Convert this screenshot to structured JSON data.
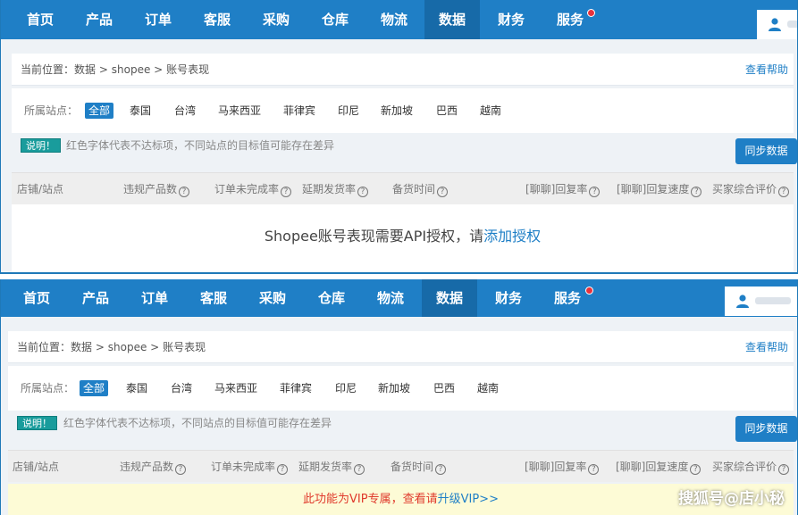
{
  "nav": {
    "items": [
      "首页",
      "产品",
      "订单",
      "客服",
      "采购",
      "仓库",
      "物流",
      "数据",
      "财务",
      "服务"
    ],
    "active": "数据"
  },
  "breadcrumb": {
    "prefix": "当前位置：",
    "path": [
      "数据",
      "shopee",
      "账号表现"
    ],
    "separator": ">"
  },
  "help_label": "查看帮助",
  "sites": {
    "label": "所属站点：",
    "options": [
      "全部",
      "泰国",
      "台湾",
      "马来西亚",
      "菲律宾",
      "印尼",
      "新加坡",
      "巴西",
      "越南"
    ],
    "selected": "全部"
  },
  "note": {
    "badge": "说明！",
    "text": "红色字体代表不达标项，不同站点的目标值可能存在差异"
  },
  "sync_button": "同步数据",
  "table": {
    "columns": [
      "店铺/站点",
      "违规产品数",
      "订单未完成率",
      "延期发货率",
      "备货时间",
      "[聊聊]回复率",
      "[聊聊]回复速度",
      "买家综合评价"
    ],
    "help_columns": [
      false,
      true,
      true,
      true,
      true,
      true,
      true,
      true
    ]
  },
  "panel_a_message": {
    "text": "Shopee账号表现需要API授权，请",
    "link": "添加授权"
  },
  "panel_b_message": {
    "text": "此功能为VIP专属，查看请",
    "link": "升级VIP>>"
  },
  "watermark": "搜狐号@店小秘",
  "colors": {
    "nav_bg": "#1f7fc6",
    "nav_active": "#176aa8",
    "accent": "#1f7fc6",
    "badge": "#199c9c",
    "warning": "#e03a2c",
    "vip_bg": "#fdfbd6"
  },
  "icons": {
    "user": "user-icon",
    "help": "question-circle-icon",
    "notification": "notification-dot-icon"
  }
}
